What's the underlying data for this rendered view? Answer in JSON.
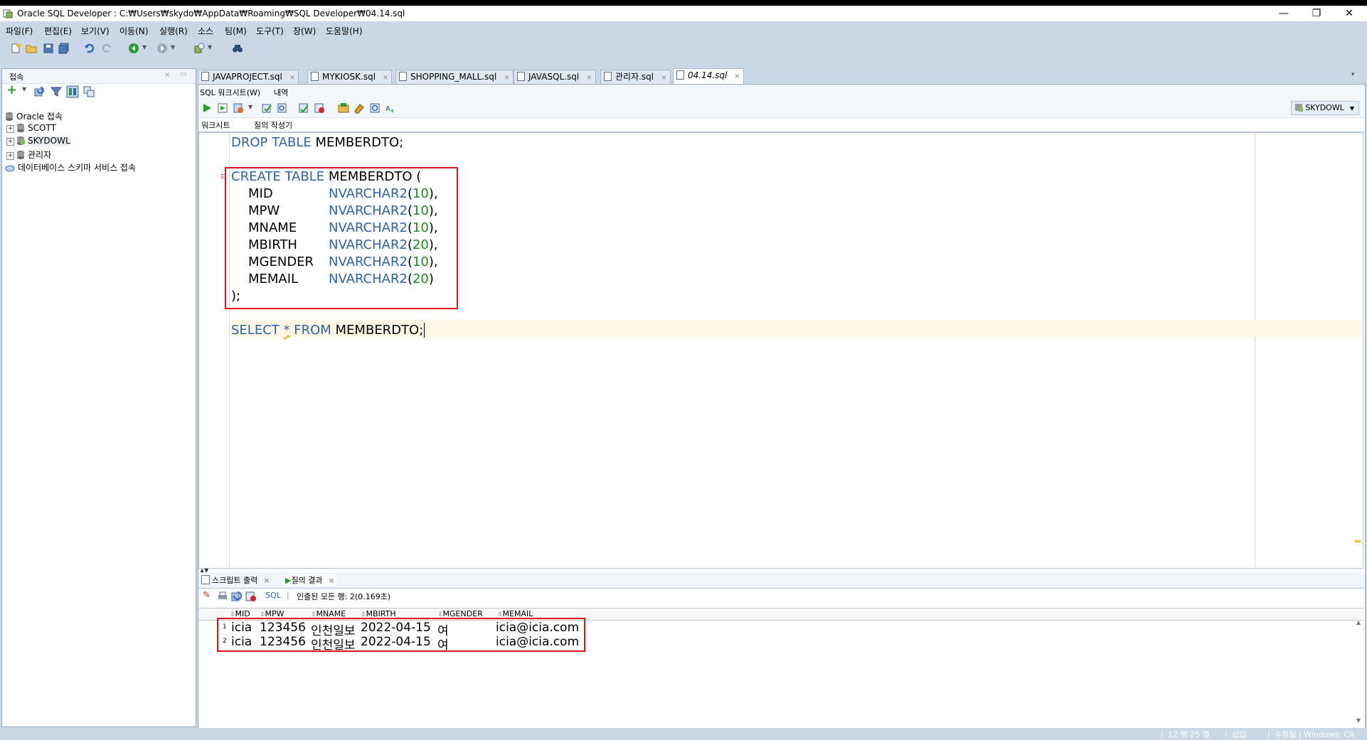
{
  "window": {
    "title": "Oracle SQL Developer : C:₩Users₩skydo₩AppData₩Roaming₩SQL Developer₩04.14.sql",
    "minimize": "—",
    "restore": "❐",
    "close": "✕"
  },
  "menu": [
    "파일(F)",
    "편집(E)",
    "보기(V)",
    "이동(N)",
    "실행(R)",
    "소스",
    "팀(M)",
    "도구(T)",
    "창(W)",
    "도움말(H)"
  ],
  "sidebar": {
    "title": "접속",
    "tree": [
      {
        "label": "Oracle 접속",
        "expander": ""
      },
      {
        "label": "SCOTT",
        "expander": "+"
      },
      {
        "label": "SKYDOWL",
        "expander": "+"
      },
      {
        "label": "관리자",
        "expander": "+"
      },
      {
        "label": "데이터베이스 스키마 서비스 접속",
        "expander": ""
      }
    ]
  },
  "tabs": [
    "JAVAPROJECT.sql",
    "MYKIOSK.sql",
    "SHOPPING_MALL.sql",
    "JAVASQL.sql",
    "관리자.sql",
    "04.14.sql"
  ],
  "worksheet": {
    "header_tab1": "SQL 워크시트(W)",
    "header_tab2": "내역",
    "connection": "SKYDOWL",
    "subtab1": "워크시트",
    "subtab2": "질의 작성기"
  },
  "code": {
    "drop_kw": "DROP TABLE",
    "drop_rest": " MEMBERDTO;",
    "create_kw": "CREATE TABLE",
    "create_rest": " MEMBERDTO (",
    "columns": [
      {
        "name": "MID",
        "type": "NVARCHAR2",
        "size": "10",
        "end": "),"
      },
      {
        "name": "MPW",
        "type": "NVARCHAR2",
        "size": "10",
        "end": "),"
      },
      {
        "name": "MNAME",
        "type": "NVARCHAR2",
        "size": "10",
        "end": "),"
      },
      {
        "name": "MBIRTH",
        "type": "NVARCHAR2",
        "size": "20",
        "end": "),"
      },
      {
        "name": "MGENDER",
        "type": "NVARCHAR2",
        "size": "10",
        "end": "),"
      },
      {
        "name": "MEMAIL",
        "type": "NVARCHAR2",
        "size": "20",
        "end": ")"
      }
    ],
    "close": ");",
    "select_kw1": "SELECT",
    "select_star": "*",
    "select_kw2": "FROM",
    "select_rest": "MEMBERDTO;"
  },
  "results": {
    "tab_script": "스크립트 출력",
    "tab_query": "질의 결과",
    "sql_link": "SQL",
    "status": "인출된 모든 행: 2(0.169초)",
    "columns": [
      "MID",
      "MPW",
      "MNAME",
      "MBIRTH",
      "MGENDER",
      "MEMAIL"
    ],
    "rows": [
      {
        "n": "1",
        "cells": [
          "icia",
          "123456",
          "인천일보",
          "2022-04-15",
          "여",
          "icia@icia.com"
        ]
      },
      {
        "n": "2",
        "cells": [
          "icia",
          "123456",
          "인천일보",
          "2022-04-15",
          "여",
          "icia@icia.com"
        ]
      }
    ]
  },
  "status_bar": {
    "pos": "12 행 25 열",
    "mode": "삽입",
    "state": "수정됨 | Windows: CR"
  },
  "colors": {
    "keyword": "#2e63a6",
    "number": "#1f8a1f",
    "highlight": "#e0141e"
  }
}
